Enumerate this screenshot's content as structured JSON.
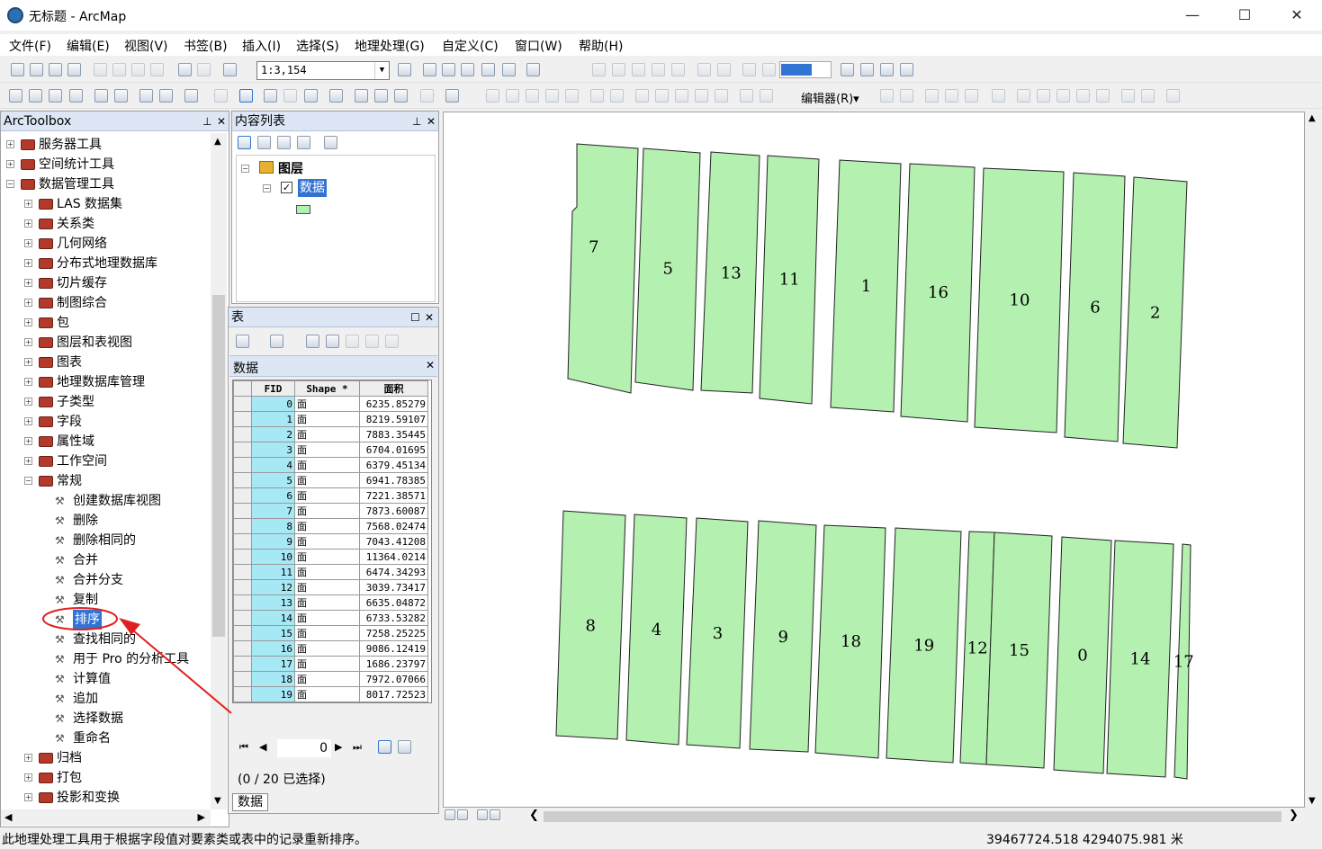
{
  "window": {
    "title": "无标题 - ArcMap",
    "minimize": "—",
    "maximize": "☐",
    "close": "✕"
  },
  "menu": [
    "文件(F)",
    "编辑(E)",
    "视图(V)",
    "书签(B)",
    "插入(I)",
    "选择(S)",
    "地理处理(G)",
    "自定义(C)",
    "窗口(W)",
    "帮助(H)"
  ],
  "toolbar": {
    "scale": "1:3,154",
    "editor_label": "编辑器(R)▾"
  },
  "toolbox": {
    "title": "ArcToolbox",
    "top_items": [
      "服务器工具",
      "空间统计工具",
      "数据管理工具"
    ],
    "sub_items": [
      "LAS 数据集",
      "关系类",
      "几何网络",
      "分布式地理数据库",
      "切片缓存",
      "制图综合",
      "包",
      "图层和表视图",
      "图表",
      "地理数据库管理",
      "子类型",
      "字段",
      "属性域",
      "工作空间",
      "常规"
    ],
    "tools": [
      "创建数据库视图",
      "删除",
      "删除相同的",
      "合并",
      "合并分支",
      "复制",
      "排序",
      "查找相同的",
      "用于 Pro 的分析工具",
      "计算值",
      "追加",
      "选择数据",
      "重命名"
    ],
    "bottom_items": [
      "归档",
      "打包",
      "投影和变换"
    ]
  },
  "toc": {
    "title": "内容列表",
    "layers_label": "图层",
    "layer_name": "数据",
    "fill_color": "#b4f0b0"
  },
  "table_window": {
    "title": "表",
    "tab_title": "数据",
    "columns": [
      "FID",
      "Shape *",
      "面积"
    ],
    "rows": [
      [
        "0",
        "面",
        "6235.85279"
      ],
      [
        "1",
        "面",
        "8219.59107"
      ],
      [
        "2",
        "面",
        "7883.35445"
      ],
      [
        "3",
        "面",
        "6704.01695"
      ],
      [
        "4",
        "面",
        "6379.45134"
      ],
      [
        "5",
        "面",
        "6941.78385"
      ],
      [
        "6",
        "面",
        "7221.38571"
      ],
      [
        "7",
        "面",
        "7873.60087"
      ],
      [
        "8",
        "面",
        "7568.02474"
      ],
      [
        "9",
        "面",
        "7043.41208"
      ],
      [
        "10",
        "面",
        "11364.0214"
      ],
      [
        "11",
        "面",
        "6474.34293"
      ],
      [
        "12",
        "面",
        "3039.73417"
      ],
      [
        "13",
        "面",
        "6635.04872"
      ],
      [
        "14",
        "面",
        "6733.53282"
      ],
      [
        "15",
        "面",
        "7258.25225"
      ],
      [
        "16",
        "面",
        "9086.12419"
      ],
      [
        "17",
        "面",
        "1686.23797"
      ],
      [
        "18",
        "面",
        "7972.07066"
      ],
      [
        "19",
        "面",
        "8017.72523"
      ]
    ],
    "record_value": "0",
    "selection_status": "(0 / 20 已选择)",
    "bottom_tab": "数据"
  },
  "map": {
    "polygon_fill": "#b4f0b0",
    "top_row_labels": [
      "7",
      "5",
      "13",
      "11",
      "1",
      "16",
      "10",
      "6",
      "2"
    ],
    "bottom_row_labels": [
      "8",
      "4",
      "3",
      "9",
      "18",
      "19",
      "12",
      "15",
      "0",
      "14",
      "17"
    ]
  },
  "status": {
    "message": "此地理处理工具用于根据字段值对要素类或表中的记录重新排序。",
    "coordinates": "39467724.518  4294075.981 米"
  },
  "annotation_color": "#e02020"
}
